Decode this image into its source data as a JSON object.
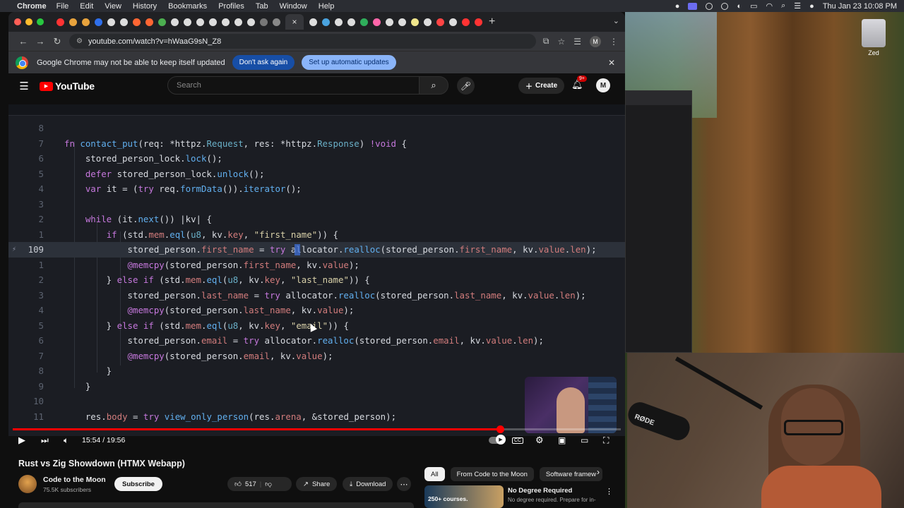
{
  "menubar": {
    "app": "Chrome",
    "items": [
      "File",
      "Edit",
      "View",
      "History",
      "Bookmarks",
      "Profiles",
      "Tab",
      "Window",
      "Help"
    ],
    "clock": "Thu Jan 23  10:08 PM"
  },
  "desktop": {
    "app_label": "Zed",
    "mic_brand": "RØDE"
  },
  "browser": {
    "url": "youtube.com/watch?v=hWaaG9sN_Z8",
    "avatar_letter": "M",
    "infobar": {
      "message": "Google Chrome may not be able to keep itself updated",
      "dont_ask": "Don't ask again",
      "setup": "Set up automatic updates"
    }
  },
  "youtube": {
    "logo": "YouTube",
    "search_placeholder": "Search",
    "create_label": "Create",
    "notification_count": "9+",
    "avatar_letter": "M"
  },
  "code": {
    "lines": [
      {
        "num": "8"
      },
      {
        "num": "7"
      },
      {
        "num": "6"
      },
      {
        "num": "5"
      },
      {
        "num": "4"
      },
      {
        "num": "3"
      },
      {
        "num": "2"
      },
      {
        "num": "1"
      },
      {
        "num": "109"
      },
      {
        "num": "1"
      },
      {
        "num": "2"
      },
      {
        "num": "3"
      },
      {
        "num": "4"
      },
      {
        "num": "5"
      },
      {
        "num": "6"
      },
      {
        "num": "7"
      },
      {
        "num": "8"
      },
      {
        "num": "9"
      },
      {
        "num": "10"
      },
      {
        "num": "11"
      }
    ]
  },
  "player": {
    "time": "15:54 / 19:56",
    "progress_fraction": 0.802
  },
  "video": {
    "title": "Rust vs Zig Showdown (HTMX Webapp)",
    "channel": "Code to the Moon",
    "subscribers": "75.5K subscribers",
    "subscribe_label": "Subscribe",
    "likes": "517",
    "share_label": "Share",
    "download_label": "Download"
  },
  "sidebar": {
    "chips": [
      "All",
      "From Code to the Moon",
      "Software framew"
    ],
    "ad": {
      "thumb_text": "250+ courses.",
      "title": "No Degree Required",
      "desc": "No degree required. Prepare for in-"
    }
  },
  "colors": {
    "youtube_red": "#ff0000",
    "keyword": "#c678dd",
    "function": "#61afef",
    "string": "#d8d0a8",
    "property": "#d27c7c"
  }
}
